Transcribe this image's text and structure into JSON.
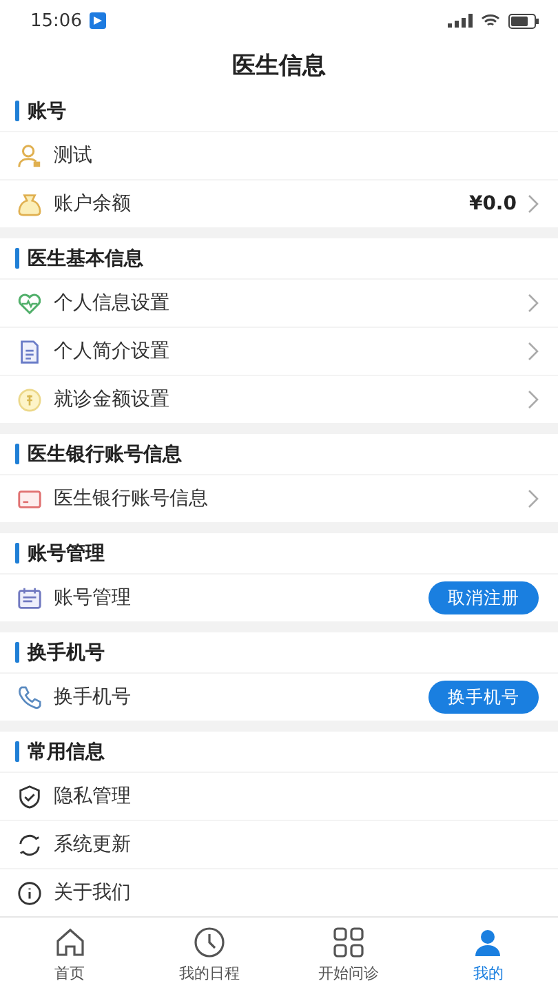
{
  "status_bar": {
    "time": "15:06"
  },
  "title": "医生信息",
  "sections": [
    {
      "title": "账号",
      "items": [
        {
          "label": "测试",
          "kind": "plain"
        },
        {
          "label": "账户余额",
          "kind": "value",
          "value": "¥0.0"
        }
      ]
    },
    {
      "title": "医生基本信息",
      "items": [
        {
          "label": "个人信息设置",
          "kind": "link"
        },
        {
          "label": "个人简介设置",
          "kind": "link"
        },
        {
          "label": "就诊金额设置",
          "kind": "link"
        }
      ]
    },
    {
      "title": "医生银行账号信息",
      "items": [
        {
          "label": "医生银行账号信息",
          "kind": "link"
        }
      ]
    },
    {
      "title": "账号管理",
      "items": [
        {
          "label": "账号管理",
          "kind": "button",
          "button": "取消注册"
        }
      ]
    },
    {
      "title": "换手机号",
      "items": [
        {
          "label": "换手机号",
          "kind": "button",
          "button": "换手机号"
        }
      ]
    },
    {
      "title": "常用信息",
      "items": [
        {
          "label": "隐私管理",
          "kind": "plain"
        },
        {
          "label": "系统更新",
          "kind": "plain"
        },
        {
          "label": "关于我们",
          "kind": "plain"
        }
      ]
    }
  ],
  "tabs": [
    {
      "label": "首页",
      "selected": false
    },
    {
      "label": "我的日程",
      "selected": false
    },
    {
      "label": "开始问诊",
      "selected": false
    },
    {
      "label": "我的",
      "selected": true
    }
  ]
}
